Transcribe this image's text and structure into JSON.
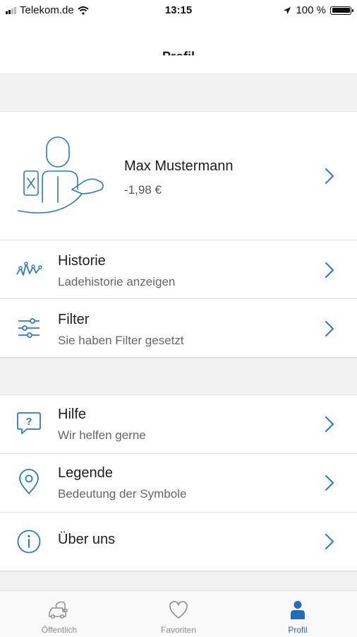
{
  "status_bar": {
    "carrier": "Telekom.de",
    "time": "13:15",
    "battery": "100 %"
  },
  "nav": {
    "title": "Profil"
  },
  "profile": {
    "name": "Max Mustermann",
    "balance": "-1,98 €"
  },
  "menu": [
    {
      "title": "Historie",
      "subtitle": "Ladehistorie anzeigen",
      "icon": "history-chart-icon"
    },
    {
      "title": "Filter",
      "subtitle": "Sie haben Filter gesetzt",
      "icon": "filter-sliders-icon"
    },
    {
      "title": "Hilfe",
      "subtitle": "Wir helfen gerne",
      "icon": "help-bubble-icon"
    },
    {
      "title": "Legende",
      "subtitle": "Bedeutung der Symbole",
      "icon": "map-pin-icon"
    },
    {
      "title": "Über uns",
      "subtitle": "",
      "icon": "info-icon"
    }
  ],
  "tabs": [
    {
      "label": "Öffentlich",
      "icon": "car-charging-icon",
      "active": false
    },
    {
      "label": "Favoriten",
      "icon": "heart-icon",
      "active": false
    },
    {
      "label": "Profil",
      "icon": "person-icon",
      "active": true
    }
  ],
  "colors": {
    "accent": "#1f6fb8",
    "separator": "#e2e2e2",
    "band": "#f2f2f2"
  }
}
